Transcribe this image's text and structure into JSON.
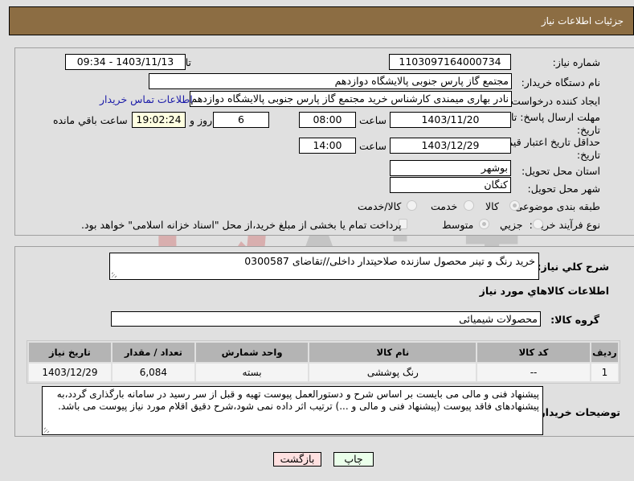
{
  "header": {
    "title": "جزئیات اطلاعات نیاز"
  },
  "form": {
    "need_number_label": "شماره نیاز:",
    "need_number": "1103097164000734",
    "announce_label": "تاریخ و ساعت اعلان عمومی:",
    "announce_value": "1403/11/13 - 09:34",
    "buyer_org_label": "نام دستگاه خریدار:",
    "buyer_org": "مجتمع گاز پارس جنوبی  پالایشگاه دوازدهم",
    "creator_label": "ایجاد کننده درخواست:",
    "creator": "نادر بهاری میمندی کارشناس خرید مجتمع گاز پارس جنوبی  پالایشگاه دوازدهم",
    "contact_link": "اطلاعات تماس خریدار",
    "deadline_label_line1": "مهلت ارسال پاسخ: تا",
    "deadline_label_line2": "تاریخ:",
    "deadline_date": "1403/11/20",
    "time_label": "ساعت",
    "deadline_time": "08:00",
    "remaining_days": "6",
    "days_and_label": "روز و",
    "remaining_time": "19:02:24",
    "remaining_suffix": "ساعت باقي مانده",
    "price_validity_label_line1": "حداقل تاریخ اعتبار قیمت: تا",
    "price_validity_label_line2": "تاریخ:",
    "price_validity_date": "1403/12/29",
    "price_validity_time": "14:00",
    "province_label": "استان محل تحویل:",
    "province": "بوشهر",
    "city_label": "شهر محل تحویل:",
    "city": "کنگان",
    "category_label": "طبقه بندی موضوعی:",
    "category_options": [
      {
        "label": "کالا",
        "selected": true
      },
      {
        "label": "خدمت",
        "selected": false
      },
      {
        "label": "کالا/خدمت",
        "selected": false
      }
    ],
    "process_label": "نوع فرآیند خرید :",
    "process_options": [
      {
        "label": "جزيي",
        "selected": false
      },
      {
        "label": "متوسط",
        "selected": true
      }
    ],
    "payment_note": "پرداخت تمام یا بخشی از مبلغ خرید،از محل \"اسناد خزانه اسلامی\" خواهد بود.",
    "payment_checked": false
  },
  "details": {
    "description_label": "شرح کلي نیاز:",
    "description": "خرید رنگ و تینر محصول سازنده صلاحیتدار داخلی//تقاضای 0300587",
    "items_heading": "اطلاعات کالاهاي مورد نیاز",
    "goods_group_label": "گروه کالا:",
    "goods_group": "محصولات شیمیائی",
    "table": {
      "columns": [
        "ردیف",
        "کد کالا",
        "نام کالا",
        "واحد شمارش",
        "تعداد / مقدار",
        "تاریخ نیاز"
      ],
      "rows": [
        [
          "1",
          "--",
          "رنگ پوششی",
          "بسته",
          "6,084",
          "1403/12/29"
        ]
      ]
    },
    "buyer_notes_label": "توضیحات خریدار:",
    "buyer_notes": "پیشنهاد فنی و مالی می بایست بر اساس شرح و دستورالعمل پیوست تهیه و قبل از سر رسید در سامانه بارگذاری گردد،به پیشنهادهای فاقد پیوست (پیشنهاد فنی و مالی و ...) ترتیب اثر داده نمی شود،شرح دقیق اقلام مورد نیاز پیوست می باشد."
  },
  "buttons": {
    "print": "چاپ",
    "back": "بازگشت"
  },
  "watermark": {
    "text": "AriaTender.neT"
  },
  "colors": {
    "header_bg": "#8c6d43",
    "print_bg": "#eaffea",
    "back_bg": "#ffe0e0",
    "link": "#1a1aa8"
  }
}
